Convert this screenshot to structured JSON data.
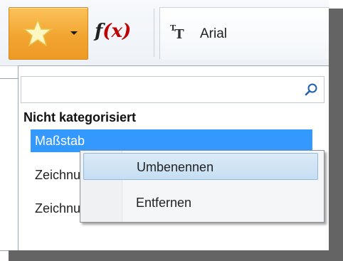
{
  "toolbar": {
    "favorites_icon": "star-icon",
    "formula_label_f": "f",
    "formula_label_x": "(x)",
    "font_icon": "font-tt-icon",
    "font_name": "Arial"
  },
  "panel": {
    "search_placeholder": "",
    "search_icon": "magnifier-icon",
    "group_title": "Nicht kategorisiert",
    "items": [
      {
        "label": "Maßstab"
      },
      {
        "label": "Zeichnungsrahmen"
      },
      {
        "label": "Zeichnungskopf"
      }
    ]
  },
  "context_menu": {
    "items": [
      {
        "label": "Umbenennen"
      },
      {
        "label": "Entfernen"
      }
    ]
  },
  "colors": {
    "selection": "#3399ff",
    "favorite_button": "#f2a531",
    "formula_x": "#c00000"
  }
}
